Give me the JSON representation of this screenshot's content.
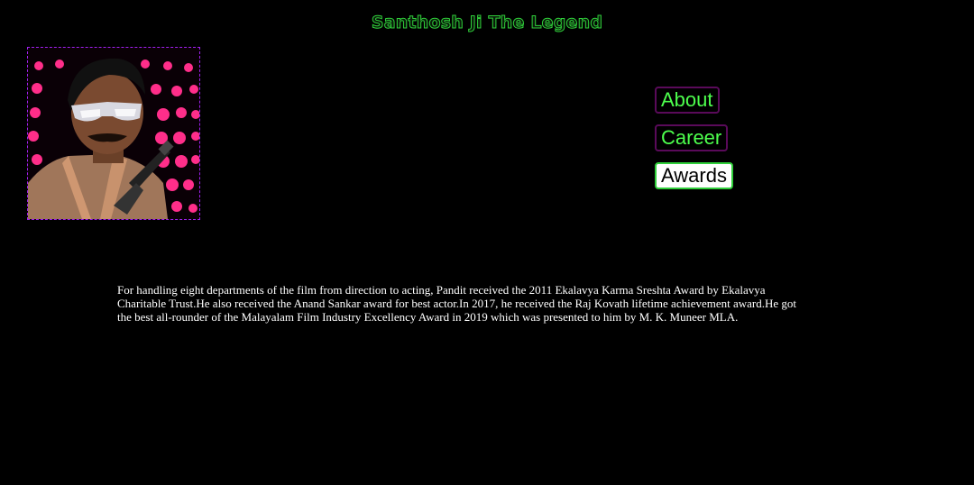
{
  "header": {
    "title": "Santhosh Ji The Legend"
  },
  "portrait": {
    "icon": "portrait-photo",
    "colors": {
      "background": "#0a0006",
      "dots": "#ff2e8a",
      "border": "#a020f0"
    }
  },
  "nav": {
    "items": [
      {
        "label": "About",
        "active": false
      },
      {
        "label": "Career",
        "active": false
      },
      {
        "label": "Awards",
        "active": true
      }
    ]
  },
  "main": {
    "text": "For handling eight departments of the film from direction to acting, Pandit received the 2011 Ekalavya Karma Sreshta Award by Ekalavya Charitable Trust.He also received the Anand Sankar award for best actor.In 2017, he received the Raj Kovath lifetime achievement award.He got the best all-rounder of the Malayalam Film Industry Excellency Award in 2019 which was presented to him by M. K. Muneer MLA."
  },
  "colors": {
    "page_background": "#000000",
    "title_green": "#2fcf3a",
    "nav_text": "#4dff4d",
    "nav_border": "#5a0a5a",
    "active_bg": "#ffffff",
    "body_text": "#ffffff"
  }
}
